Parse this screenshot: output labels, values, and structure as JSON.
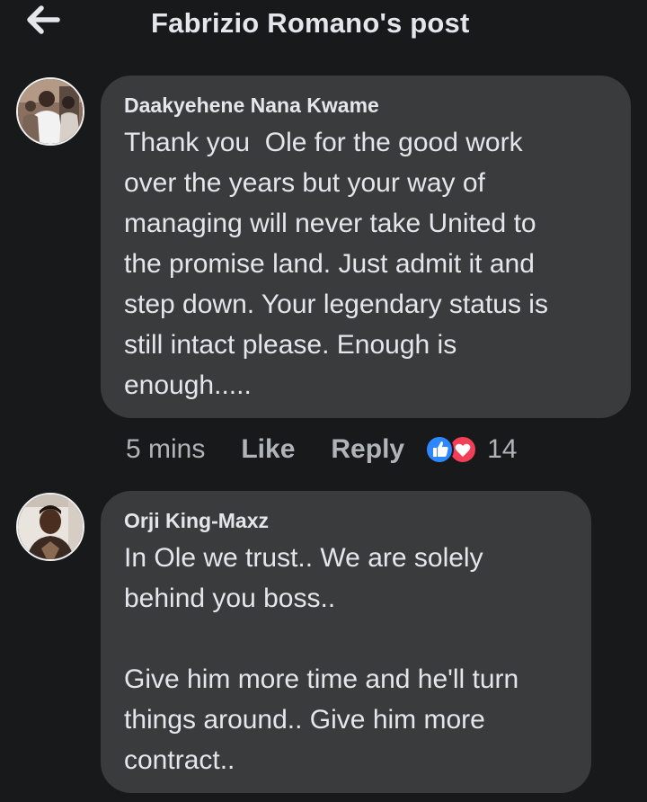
{
  "header": {
    "title": "Fabrizio Romano's post",
    "back_icon": "arrow-left-icon"
  },
  "comments": [
    {
      "author": "Daakyehene Nana Kwame",
      "text": "Thank you  Ole for the good work\nover the years but your way of\nmanaging will never take United to\nthe promise land. Just admit it and\nstep down. Your legendary status is\nstill intact please. Enough is\nenough.....",
      "time": "5 mins",
      "like_label": "Like",
      "reply_label": "Reply",
      "reaction_count": "14",
      "reaction_icons": [
        "like-reaction-icon",
        "love-reaction-icon"
      ]
    },
    {
      "author": "Orji King-Maxz",
      "text": "In Ole we trust.. We are solely\nbehind you boss..\n\nGive him more time and he'll turn\nthings around.. Give him more\ncontract.."
    }
  ],
  "colors": {
    "background": "#18191a",
    "bubble": "#3a3b3c",
    "text": "#e4e6eb",
    "secondary_text": "#b0b3b8",
    "like_blue": "#2d88ff",
    "love_red": "#f33e58"
  }
}
